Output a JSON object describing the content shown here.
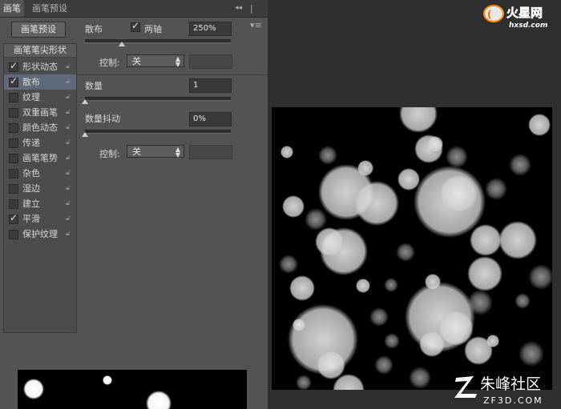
{
  "tabs": {
    "brush": "画笔",
    "brush_preset": "画笔预设",
    "collapse_icon": "◂◂",
    "menu_icon": "|▾≡"
  },
  "preset_button": "画笔预设",
  "tip_shape": "画笔笔尖形状",
  "items": [
    {
      "label": "形状动态",
      "checked": true,
      "selected": false
    },
    {
      "label": "散布",
      "checked": true,
      "selected": true
    },
    {
      "label": "纹理",
      "checked": false,
      "selected": false
    },
    {
      "label": "双重画笔",
      "checked": false,
      "selected": false
    },
    {
      "label": "颜色动态",
      "checked": false,
      "selected": false
    },
    {
      "label": "传递",
      "checked": false,
      "selected": false
    },
    {
      "label": "画笔笔势",
      "checked": false,
      "selected": false
    },
    {
      "label": "杂色",
      "checked": false,
      "selected": false
    },
    {
      "label": "湿边",
      "checked": false,
      "selected": false
    },
    {
      "label": "建立",
      "checked": false,
      "selected": false
    },
    {
      "label": "平滑",
      "checked": true,
      "selected": false
    },
    {
      "label": "保护纹理",
      "checked": false,
      "selected": false
    }
  ],
  "scatter": {
    "label": "散布",
    "both_axes_label": "两轴",
    "both_axes_checked": true,
    "value": "250%",
    "slider_fraction": 0.25,
    "control_label": "控制:",
    "control_value": "关"
  },
  "count": {
    "label": "数量",
    "value": "1",
    "slider_fraction": 0.0
  },
  "count_jitter": {
    "label": "数量抖动",
    "value": "0%",
    "slider_fraction": 0.0,
    "control_label": "控制:",
    "control_value": "关"
  },
  "watermark_top": {
    "text": "火星网",
    "sub": "hxsd.com"
  },
  "watermark_bottom": {
    "text": "朱峰社区",
    "sub": "ZF3D.COM"
  },
  "colors": {
    "panel": "#535353",
    "selected": "#5e6a7b",
    "background": "#2f2f2f"
  }
}
